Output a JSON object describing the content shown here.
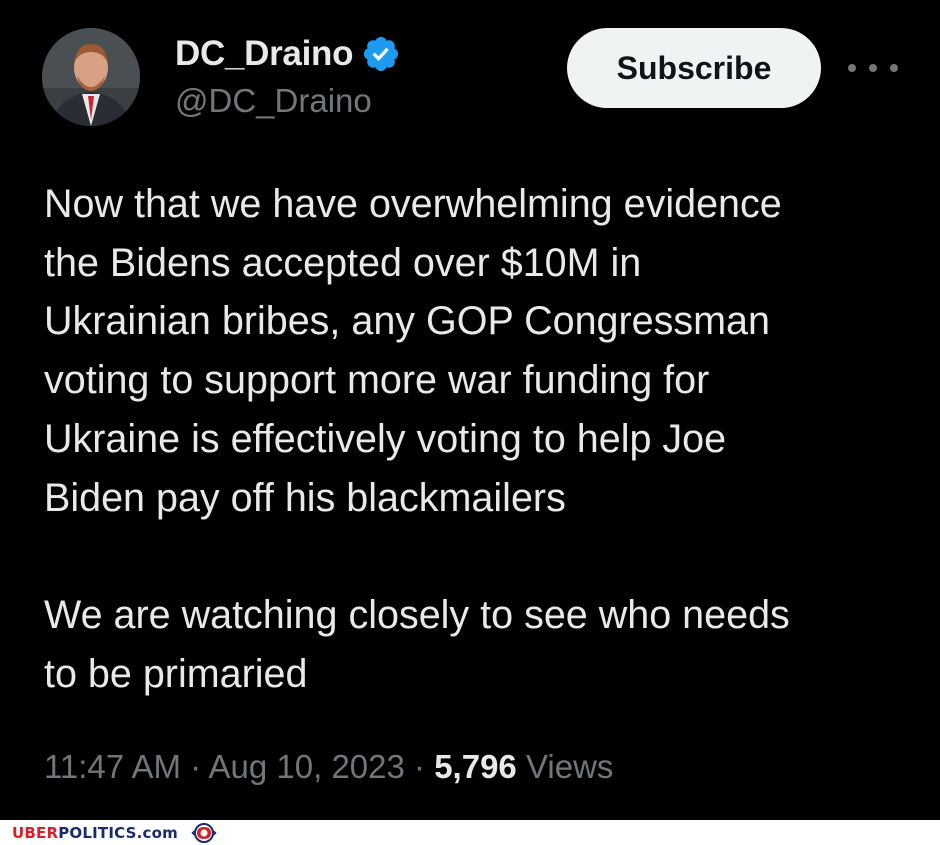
{
  "author": {
    "display_name": "DC_Draino",
    "handle": "@DC_Draino",
    "verified": true
  },
  "actions": {
    "subscribe_label": "Subscribe",
    "more_icon": "more-horizontal-icon"
  },
  "tweet": {
    "paragraphs": [
      "Now that we have overwhelming evidence\nthe Bidens accepted over $10M in\nUkrainian bribes, any GOP Congressman\nvoting to support more war funding for\nUkraine is effectively voting to help Joe\nBiden pay off his blackmailers",
      "We are watching closely to see who needs\nto be primaried"
    ],
    "time": "11:47 AM",
    "separator": "·",
    "date": "Aug 10, 2023",
    "views_count": "5,796",
    "views_label": "Views"
  },
  "watermark": {
    "brand_uber": "UBER",
    "brand_rest": "POLITICS.com"
  },
  "colors": {
    "background": "#000000",
    "primary_text": "#e7e9ea",
    "secondary_text": "#71767b",
    "verified_blue": "#1d9bf0",
    "button_bg": "#eff3f4"
  }
}
